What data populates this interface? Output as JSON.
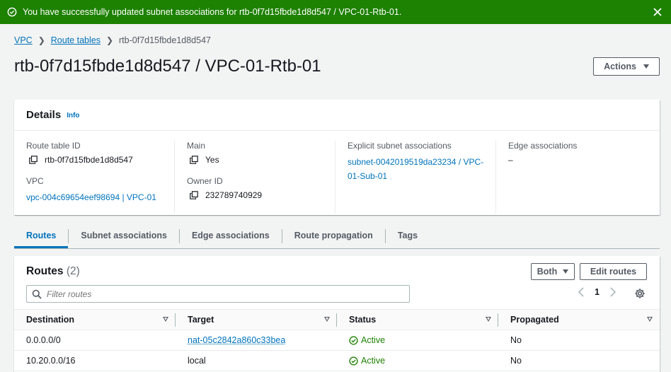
{
  "flash": {
    "message": "You have successfully updated subnet associations for rtb-0f7d15fbde1d8d547 / VPC-01-Rtb-01.",
    "color": "#1d8102"
  },
  "breadcrumb": {
    "items": [
      "VPC",
      "Route tables",
      "rtb-0f7d15fbde1d8d547"
    ]
  },
  "page": {
    "title": "rtb-0f7d15fbde1d8d547 / VPC-01-Rtb-01",
    "actions_label": "Actions"
  },
  "details": {
    "heading": "Details",
    "info_label": "Info",
    "route_table_id_label": "Route table ID",
    "route_table_id": "rtb-0f7d15fbde1d8d547",
    "vpc_label": "VPC",
    "vpc_value": "vpc-004c69654eef98694 | VPC-01",
    "main_label": "Main",
    "main_value": "Yes",
    "owner_id_label": "Owner ID",
    "owner_id_value": "232789740929",
    "explicit_label": "Explicit subnet associations",
    "explicit_value": "subnet-0042019519da23234 / VPC-01-Sub-01",
    "edge_label": "Edge associations",
    "edge_value": "–"
  },
  "tabs": [
    {
      "label": "Routes",
      "active": true
    },
    {
      "label": "Subnet associations",
      "active": false
    },
    {
      "label": "Edge associations",
      "active": false
    },
    {
      "label": "Route propagation",
      "active": false
    },
    {
      "label": "Tags",
      "active": false
    }
  ],
  "routes": {
    "heading": "Routes",
    "count": "(2)",
    "both_label": "Both",
    "edit_label": "Edit routes",
    "filter_placeholder": "Filter routes",
    "page_number": "1",
    "columns": [
      "Destination",
      "Target",
      "Status",
      "Propagated"
    ],
    "rows": [
      {
        "destination": "0.0.0.0/0",
        "target": "nat-05c2842a860c33bea",
        "target_is_link": true,
        "status": "Active",
        "propagated": "No"
      },
      {
        "destination": "10.20.0.0/16",
        "target": "local",
        "target_is_link": false,
        "status": "Active",
        "propagated": "No"
      }
    ]
  }
}
